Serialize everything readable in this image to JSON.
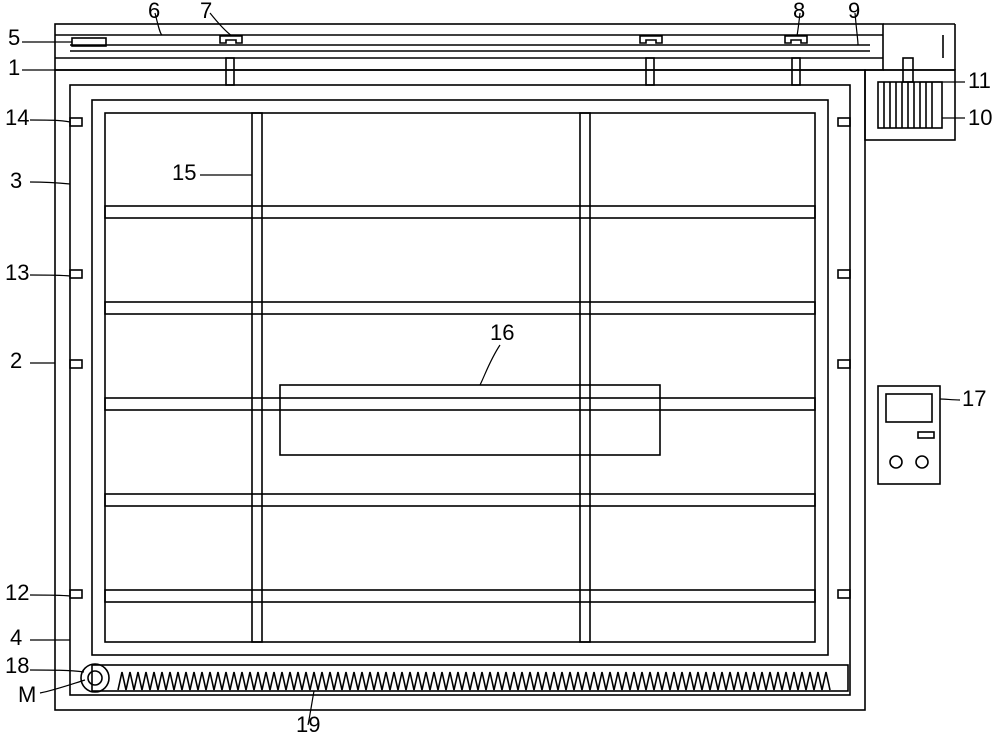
{
  "labels": {
    "n1": "1",
    "n2": "2",
    "n3": "3",
    "n4": "4",
    "n5": "5",
    "n6": "6",
    "n7": "7",
    "n8": "8",
    "n9": "9",
    "n10": "10",
    "n11": "11",
    "n12": "12",
    "n13": "13",
    "n14": "14",
    "n15": "15",
    "n16": "16",
    "n17": "17",
    "n18": "18",
    "n19": "19",
    "M": "M"
  }
}
